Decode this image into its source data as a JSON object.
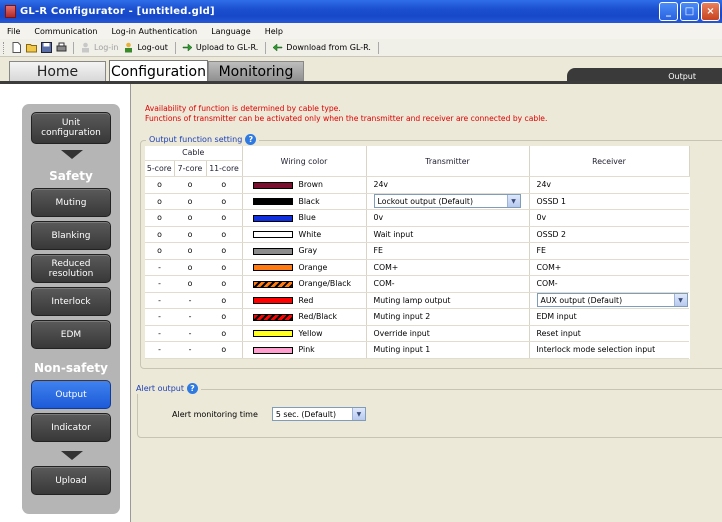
{
  "window": {
    "title": "GL-R Configurator - [untitled.gld]"
  },
  "menu": [
    "File",
    "Communication",
    "Log-in Authentication",
    "Language",
    "Help"
  ],
  "toolbar": {
    "login": "Log-in",
    "logout": "Log-out",
    "upload": "Upload to GL-R.",
    "download": "Download from GL-R."
  },
  "tabs": {
    "home": "Home",
    "configuration": "Configuration",
    "monitoring": "Monitoring"
  },
  "current_page": "Output",
  "nav": {
    "unit": "Unit configuration",
    "safety": "Safety",
    "muting": "Muting",
    "blanking": "Blanking",
    "reduced": "Reduced resolution",
    "interlock": "Interlock",
    "edm": "EDM",
    "nonsafety": "Non-safety",
    "output": "Output",
    "indicator": "Indicator",
    "upload": "Upload"
  },
  "notice": {
    "line1": "Availability of function is determined by cable type.",
    "line2": "Functions of transmitter can be activated only when the transmitter and receiver are connected by cable."
  },
  "output_group": {
    "title": "Output function setting"
  },
  "table": {
    "headers": {
      "cable": "Cable",
      "c5": "5-core",
      "c7": "7-core",
      "c11": "11-core",
      "wiring": "Wiring color",
      "transmitter": "Transmitter",
      "receiver": "Receiver"
    },
    "rows": [
      {
        "c5": "o",
        "c7": "o",
        "c11": "o",
        "color": "Brown",
        "swatch": "#7a0f2f",
        "tx": "24v",
        "rx": "24v"
      },
      {
        "c5": "o",
        "c7": "o",
        "c11": "o",
        "color": "Black",
        "swatch": "#000000",
        "tx": "Lockout output (Default)",
        "tx_select": true,
        "rx": "OSSD 1"
      },
      {
        "c5": "o",
        "c7": "o",
        "c11": "o",
        "color": "Blue",
        "swatch": "#1030e0",
        "tx": "0v",
        "rx": "0v"
      },
      {
        "c5": "o",
        "c7": "o",
        "c11": "o",
        "color": "White",
        "swatch": "#ffffff",
        "tx": "Wait input",
        "rx": "OSSD 2"
      },
      {
        "c5": "o",
        "c7": "o",
        "c11": "o",
        "color": "Gray",
        "swatch": "#8c8c8c",
        "tx": "FE",
        "rx": "FE"
      },
      {
        "c5": "-",
        "c7": "o",
        "c11": "o",
        "color": "Orange",
        "swatch": "#ff7a10",
        "tx": "COM+",
        "rx": "COM+"
      },
      {
        "c5": "-",
        "c7": "o",
        "c11": "o",
        "color": "Orange/Black",
        "swatch": "orange-black",
        "tx": "COM-",
        "rx": "COM-"
      },
      {
        "c5": "-",
        "c7": "-",
        "c11": "o",
        "color": "Red",
        "swatch": "#ff0000",
        "tx": "Muting lamp output",
        "rx": "AUX output (Default)",
        "rx_select": true
      },
      {
        "c5": "-",
        "c7": "-",
        "c11": "o",
        "color": "Red/Black",
        "swatch": "red-black",
        "tx": "Muting input 2",
        "rx": "EDM input"
      },
      {
        "c5": "-",
        "c7": "-",
        "c11": "o",
        "color": "Yellow",
        "swatch": "#ffff20",
        "tx": "Override input",
        "rx": "Reset input"
      },
      {
        "c5": "-",
        "c7": "-",
        "c11": "o",
        "color": "Pink",
        "swatch": "#ff9fd0",
        "tx": "Muting input 1",
        "rx": "Interlock mode selection input"
      }
    ]
  },
  "alert": {
    "title": "Alert output",
    "label": "Alert monitoring time",
    "value": "5 sec. (Default)"
  }
}
